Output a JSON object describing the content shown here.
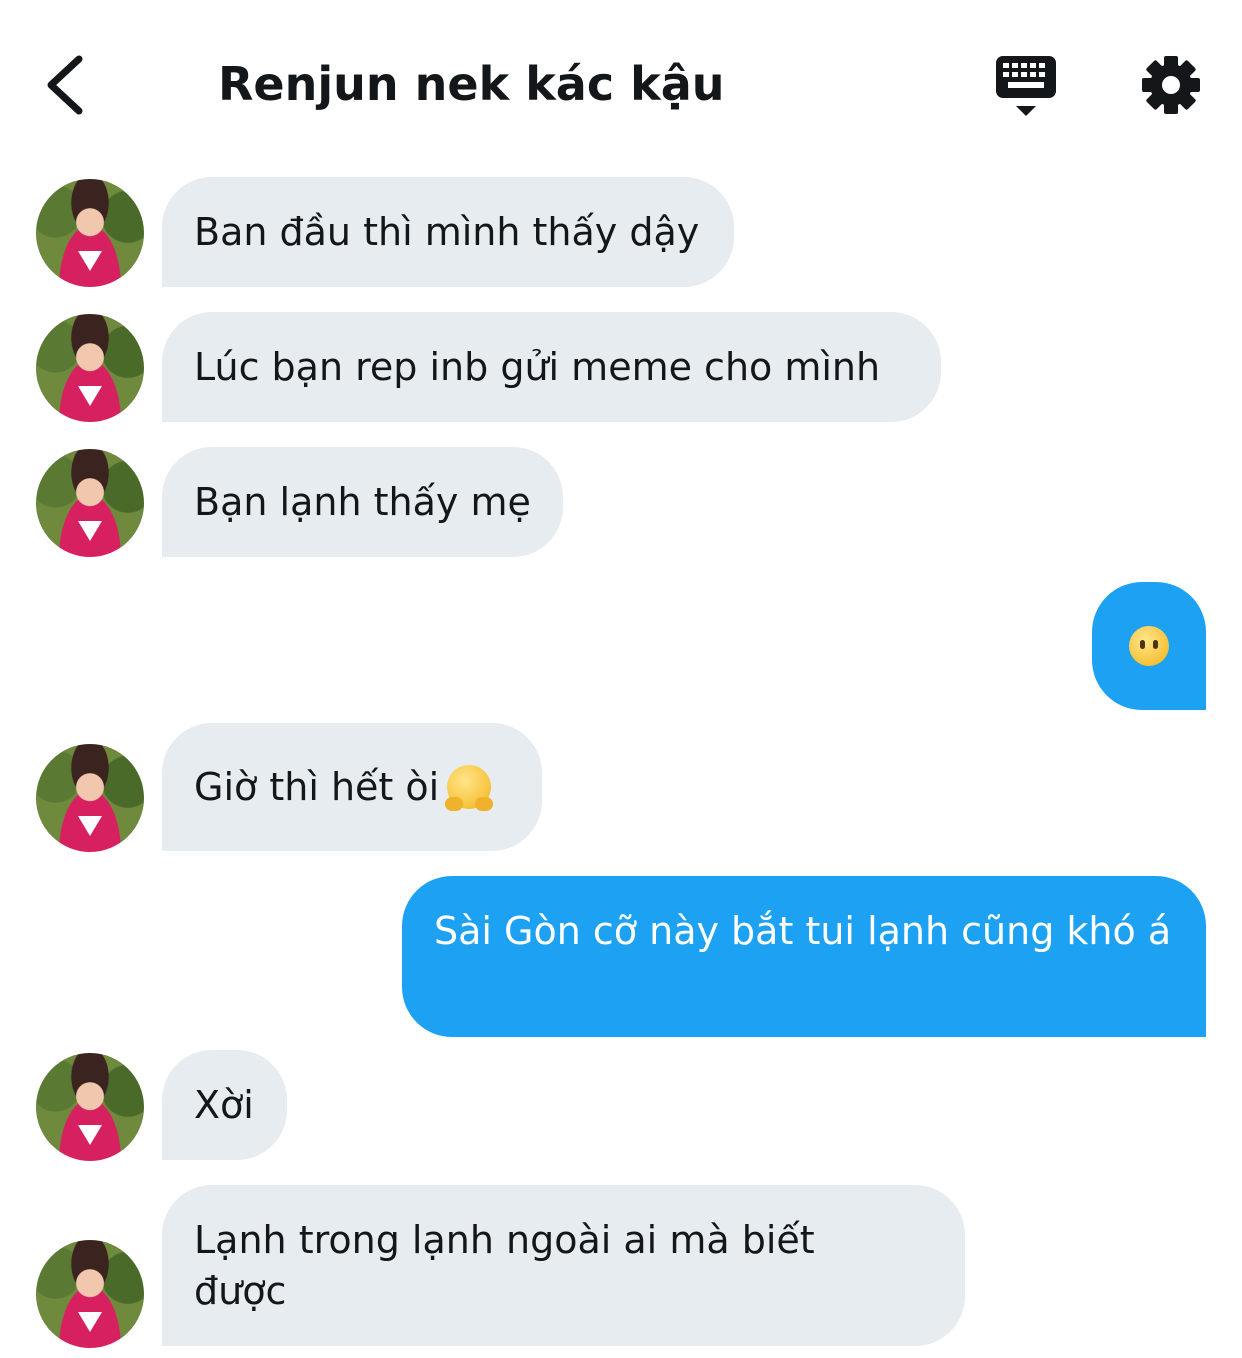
{
  "header": {
    "title": "Renjun nek kác kậu",
    "back_icon": "chevron-left-icon",
    "keyboard_icon": "keyboard-icon",
    "settings_icon": "gear-icon"
  },
  "messages": [
    {
      "direction": "incoming",
      "text": "Ban đầu thì mình thấy dậy"
    },
    {
      "direction": "incoming",
      "text": "Lúc bạn rep inb gửi meme cho mình"
    },
    {
      "direction": "incoming",
      "text": "Bạn lạnh thấy mẹ"
    },
    {
      "direction": "outgoing",
      "emoji": "face-without-mouth"
    },
    {
      "direction": "incoming",
      "text": "Giờ thì hết òi",
      "emoji": "hugging-face"
    },
    {
      "direction": "outgoing",
      "text": "Sài Gòn cỡ này bắt tui lạnh cũng khó á"
    },
    {
      "direction": "incoming",
      "text": "Xời"
    },
    {
      "direction": "incoming",
      "text": "Lạnh trong lạnh ngoài ai mà biết được"
    }
  ],
  "colors": {
    "incoming_bubble": "#e6ecf0",
    "outgoing_bubble": "#1da1f2",
    "text": "#14171a"
  }
}
